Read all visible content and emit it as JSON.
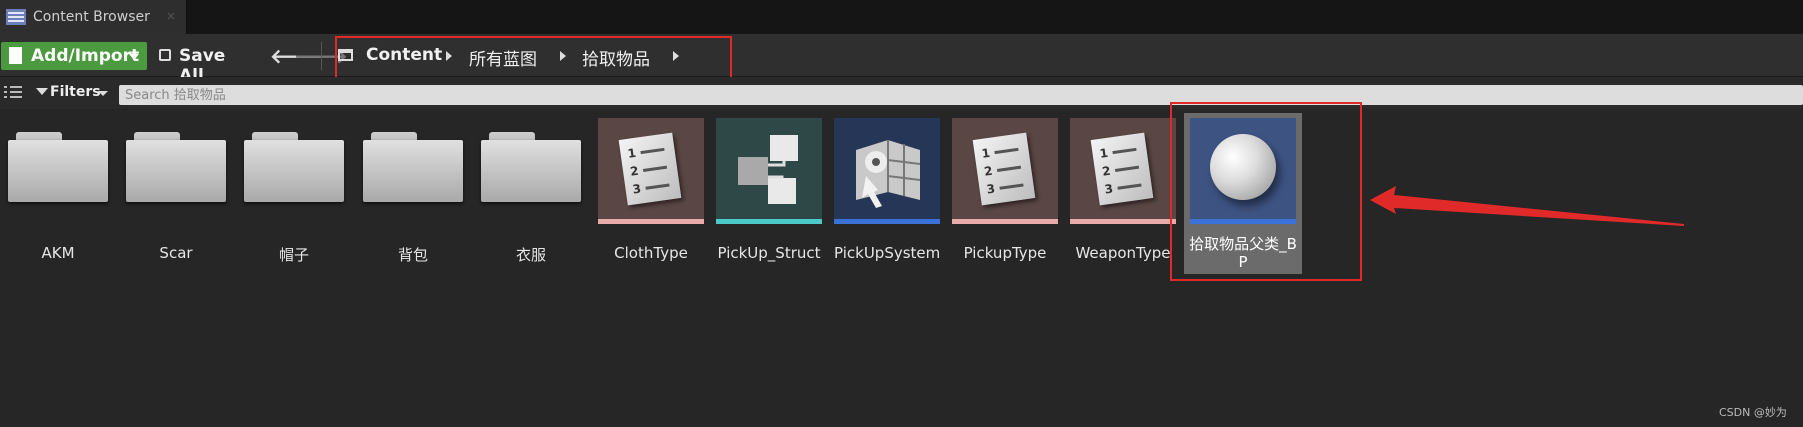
{
  "window": {
    "tab_title": "Content Browser",
    "close_glyph": "×"
  },
  "toolbar": {
    "add_import_label": "Add/Import",
    "save_all_label": "Save All",
    "back_glyph": "🡐",
    "forward_glyph": "🡒",
    "breadcrumbs": [
      "Content",
      "所有蓝图",
      "拾取物品"
    ]
  },
  "filter": {
    "filters_label": "Filters",
    "search_placeholder": "Search 拾取物品"
  },
  "folders": [
    {
      "name": "AKM"
    },
    {
      "name": "Scar"
    },
    {
      "name": "帽子"
    },
    {
      "name": "背包"
    },
    {
      "name": "衣服"
    }
  ],
  "assets": [
    {
      "name": "ClothType",
      "icon": "enum-icon",
      "tile_color": "#5a4745",
      "bar_color": "#e8a9a9"
    },
    {
      "name": "PickUp_Struct",
      "icon": "struct-icon",
      "tile_color": "#2e4747",
      "bar_color": "#4ec9c9"
    },
    {
      "name": "PickUpSystem",
      "icon": "component-icon",
      "tile_color": "#263657",
      "bar_color": "#3a72d8"
    },
    {
      "name": "PickupType",
      "icon": "enum-icon",
      "tile_color": "#5a4745",
      "bar_color": "#e8a9a9"
    },
    {
      "name": "WeaponType",
      "icon": "enum-icon",
      "tile_color": "#5a4745",
      "bar_color": "#e8a9a9"
    }
  ],
  "selected_asset": {
    "name": "拾取物品父类_BP",
    "icon": "sphere-icon",
    "tile_color": "#3d5382",
    "bar_color": "#3a72d8"
  },
  "annotations": {
    "highlight_color": "#e02a2a"
  },
  "watermark": "CSDN @妙为"
}
